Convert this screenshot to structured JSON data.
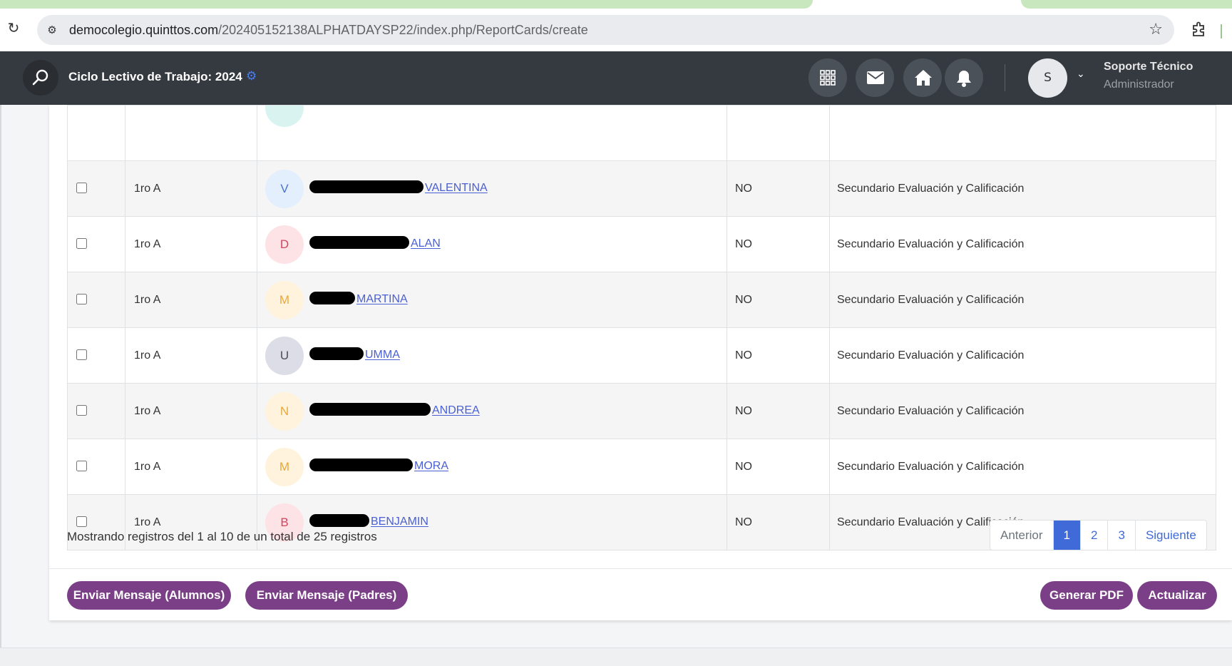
{
  "browser": {
    "url_host": "democolegio.quinttos.com",
    "url_path": "/202405152138ALPHATDAYSP22/index.php/ReportCards/create"
  },
  "header": {
    "title": "Ciclo Lectivo de Trabajo: 2024",
    "user_initial": "S",
    "user_name": "Soporte Técnico",
    "user_role": "Administrador"
  },
  "table": {
    "rows": [
      {
        "course": "1ro A",
        "initial": "V",
        "name_visible": "VALENTINA",
        "status": "NO",
        "type": "Secundario Evaluación y Calificación",
        "avatar_bg": "#e3effd",
        "avatar_fg": "#4a74c9"
      },
      {
        "course": "1ro A",
        "initial": "D",
        "name_visible": "ALAN",
        "status": "NO",
        "type": "Secundario Evaluación y Calificación",
        "avatar_bg": "#fde2e6",
        "avatar_fg": "#d2465f"
      },
      {
        "course": "1ro A",
        "initial": "M",
        "name_visible": "MARTINA",
        "status": "NO",
        "type": "Secundario Evaluación y Calificación",
        "avatar_bg": "#fff3dd",
        "avatar_fg": "#e8a93a"
      },
      {
        "course": "1ro A",
        "initial": "U",
        "name_visible": "UMMA",
        "status": "NO",
        "type": "Secundario Evaluación y Calificación",
        "avatar_bg": "#dcdde6",
        "avatar_fg": "#4a4d5a"
      },
      {
        "course": "1ro A",
        "initial": "N",
        "name_visible": "ANDREA",
        "status": "NO",
        "type": "Secundario Evaluación y Calificación",
        "avatar_bg": "#fff3dd",
        "avatar_fg": "#e8a93a"
      },
      {
        "course": "1ro A",
        "initial": "M",
        "name_visible": "MORA",
        "status": "NO",
        "type": "Secundario Evaluación y Calificación",
        "avatar_bg": "#fff3dd",
        "avatar_fg": "#e8a93a"
      },
      {
        "course": "1ro A",
        "initial": "B",
        "name_visible": "BENJAMIN",
        "status": "NO",
        "type": "Secundario Evaluación y Calificación",
        "avatar_bg": "#fde2e6",
        "avatar_fg": "#d2465f"
      }
    ]
  },
  "footer": {
    "info": "Mostrando registros del 1 al 10 de un total de 25 registros",
    "pagination": {
      "prev": "Anterior",
      "pages": [
        "1",
        "2",
        "3"
      ],
      "next": "Siguiente"
    },
    "buttons": {
      "msg_students": "Enviar Mensaje (Alumnos)",
      "msg_parents": "Enviar Mensaje (Padres)",
      "generate_pdf": "Generar PDF",
      "update": "Actualizar"
    }
  },
  "colors": {
    "header_bg": "#343a40",
    "primary": "#3f6ad8",
    "button_purple": "#7a3f87",
    "link": "#4a5fd4"
  }
}
